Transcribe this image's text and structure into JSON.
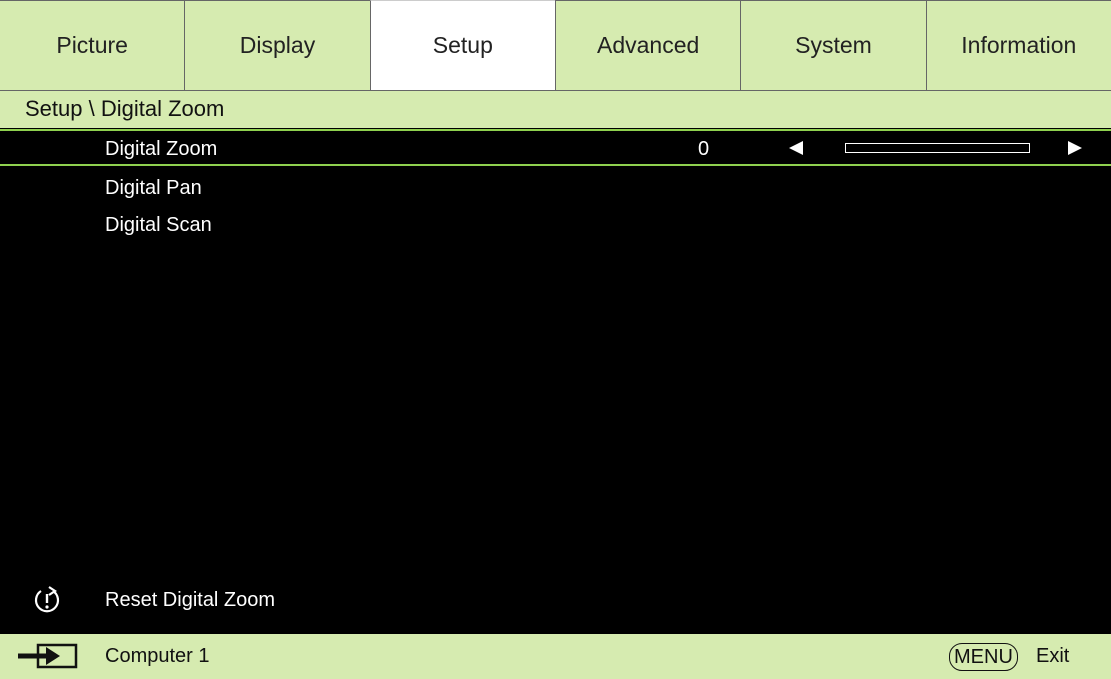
{
  "tabs": [
    {
      "label": "Picture"
    },
    {
      "label": "Display"
    },
    {
      "label": "Setup",
      "active": true
    },
    {
      "label": "Advanced"
    },
    {
      "label": "System"
    },
    {
      "label": "Information"
    }
  ],
  "breadcrumb": "Setup \\ Digital Zoom",
  "menu": {
    "items": [
      {
        "label": "Digital Zoom",
        "value": "0",
        "slider_fraction": 0
      },
      {
        "label": "Digital Pan"
      },
      {
        "label": "Digital Scan"
      }
    ]
  },
  "reset": {
    "label": "Reset Digital Zoom",
    "icon": "reset-icon"
  },
  "footer": {
    "source_label": "Computer 1",
    "source_icon": "input-source-icon",
    "menu_key": "MENU",
    "exit_label": "Exit"
  },
  "colors": {
    "tab_bg": "#d6ebb0",
    "active_tab_bg": "#ffffff",
    "highlight_border": "#8fd14f",
    "menu_bg": "#000000",
    "text_light": "#ffffff"
  }
}
